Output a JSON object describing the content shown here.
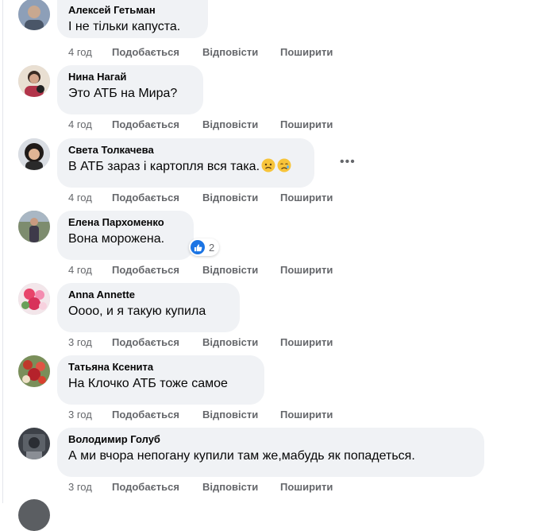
{
  "comments": [
    {
      "author": "Алексей Гетьман",
      "text": "І не тільки капуста.",
      "time": "4 год",
      "avatar": "avatar-alexey"
    },
    {
      "author": "Нина Нагай",
      "text": "Это АТБ на Мира?",
      "time": "4 год",
      "avatar": "avatar-nina"
    },
    {
      "author": "Света Толкачева",
      "text": "В АТБ зараз і картопля вся така.",
      "time": "4 год",
      "avatar": "avatar-sveta",
      "emojis": [
        "sad-face-emoji",
        "crying-face-emoji"
      ]
    },
    {
      "author": "Елена Пархоменко",
      "text": "Вона морожена.",
      "time": "4 год",
      "avatar": "avatar-elena",
      "reaction": {
        "icon": "like-icon",
        "count": "2"
      }
    },
    {
      "author": "Anna Annette",
      "text": "Оооо, и я такую купила",
      "time": "3 год",
      "avatar": "avatar-anna"
    },
    {
      "author": "Татьяна Ксенита",
      "text": "На Клочко АТБ тоже самое",
      "time": "3 год",
      "avatar": "avatar-tatiana"
    },
    {
      "author": "Володимир Голуб",
      "text": "А ми вчора непогану купили там же,мабудь як попадеться.",
      "time": "3 год",
      "avatar": "avatar-volodymyr"
    }
  ],
  "actions": {
    "like": "Подобається",
    "reply": "Відповісти",
    "share": "Поширити"
  },
  "more_options_icon": "more-horizontal-icon",
  "colors": {
    "bubble_bg": "#f0f2f5",
    "action_text": "#65676b",
    "like_blue": "#1b74e4"
  }
}
